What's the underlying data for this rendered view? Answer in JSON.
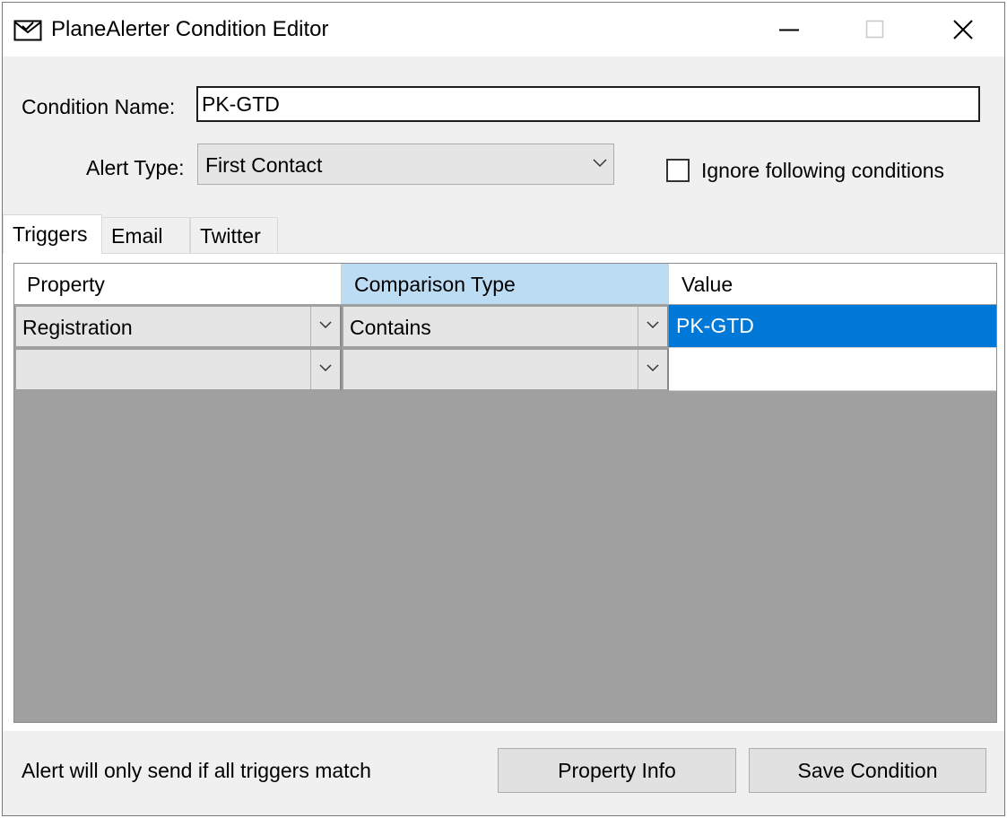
{
  "window": {
    "title": "PlaneAlerter Condition Editor",
    "app_icon": "envelope-icon",
    "controls": {
      "minimize_icon": "minimize-icon",
      "maximize_icon": "maximize-icon",
      "close_icon": "close-icon"
    }
  },
  "form": {
    "condition_name_label": "Condition Name:",
    "condition_name_value": "PK-GTD",
    "alert_type_label": "Alert Type:",
    "alert_type_value": "First Contact",
    "ignore_following_label": "Ignore following conditions",
    "ignore_following_checked": false
  },
  "tabs": [
    {
      "label": "Triggers",
      "active": true
    },
    {
      "label": "Email",
      "active": false
    },
    {
      "label": "Twitter",
      "active": false
    }
  ],
  "grid": {
    "columns": [
      "Property",
      "Comparison Type",
      "Value"
    ],
    "selected_column": "Comparison Type",
    "rows": [
      {
        "property": "Registration",
        "comparison": "Contains",
        "value": "PK-GTD",
        "selected": true
      },
      {
        "property": "",
        "comparison": "",
        "value": "",
        "selected": false
      }
    ]
  },
  "footer": {
    "hint": "Alert will only send if all triggers match",
    "property_info_label": "Property Info",
    "save_label": "Save Condition"
  },
  "colors": {
    "selection": "#0078d7",
    "header_highlight": "#bcdcf4",
    "grid_empty": "#a0a0a0",
    "window_bg": "#f0f0f0"
  }
}
